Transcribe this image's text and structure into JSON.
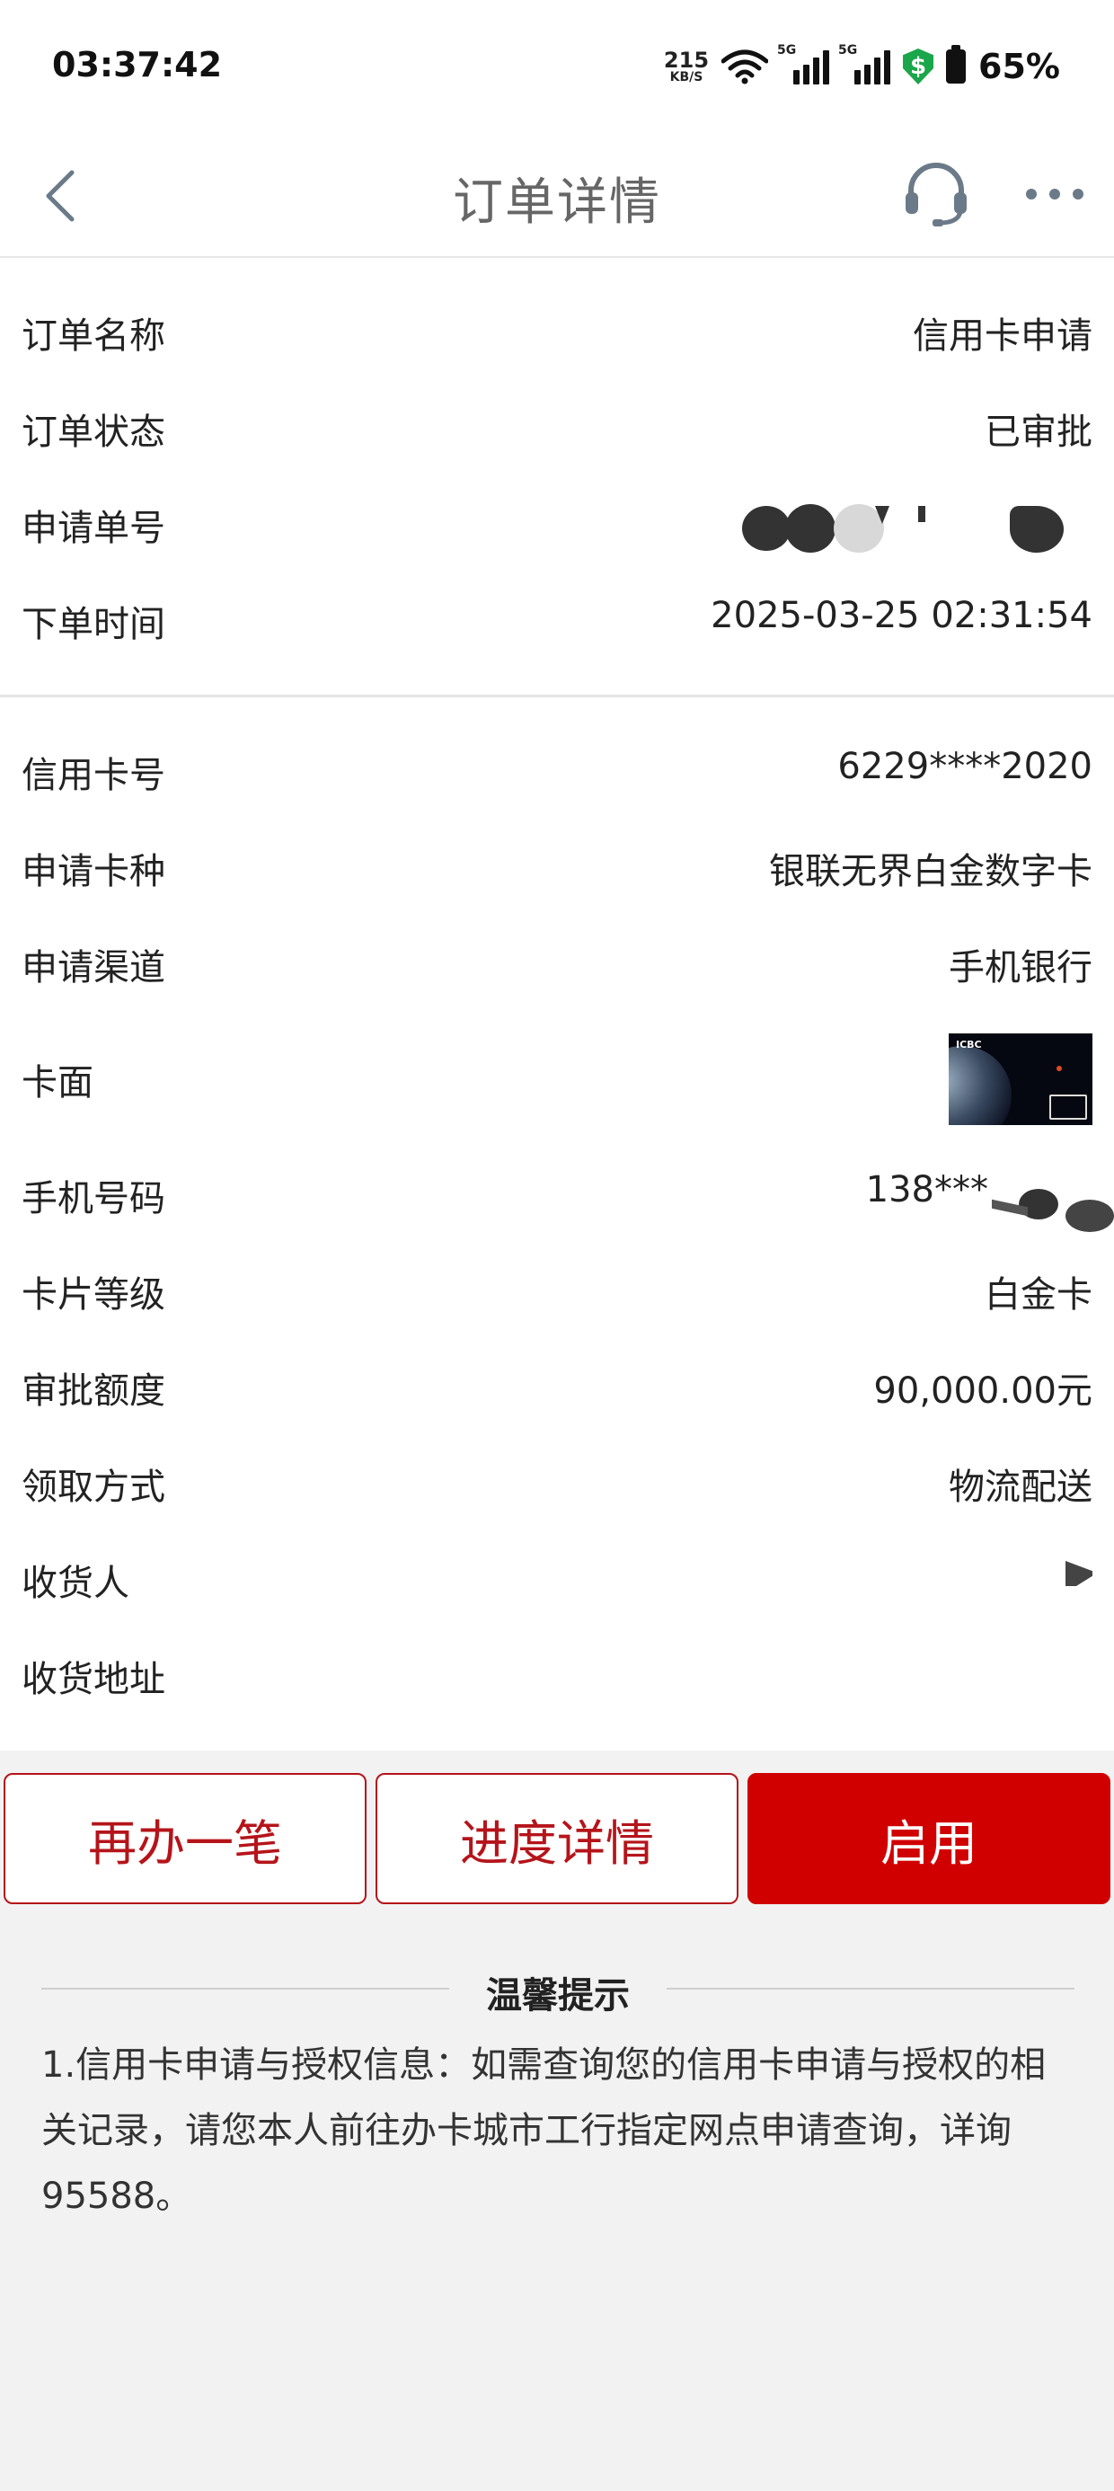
{
  "status_bar": {
    "time": "03:37:42",
    "net_speed_value": "215",
    "net_speed_unit": "KB/S",
    "signal_tag_1": "5G",
    "signal_tag_2": "5G",
    "shield_symbol": "$",
    "battery": "65%"
  },
  "header": {
    "title": "订单详情",
    "back_icon": "chevron-left-icon",
    "service_icon": "headset-icon",
    "more_icon": "more-horizontal-icon"
  },
  "order_section": {
    "name_label": "订单名称",
    "name_value": "信用卡申请",
    "status_label": "订单状态",
    "status_value": "已审批",
    "number_label": "申请单号",
    "time_label": "下单时间",
    "time_value": "2025-03-25 02:31:54"
  },
  "card_section": {
    "card_no_label": "信用卡号",
    "card_no_value": "6229****2020",
    "card_type_label": "申请卡种",
    "card_type_value": "银联无界白金数字卡",
    "channel_label": "申请渠道",
    "channel_value": "手机银行",
    "card_face_label": "卡面",
    "card_face_logo": "ICBC",
    "phone_label": "手机号码",
    "phone_value": "138***",
    "level_label": "卡片等级",
    "level_value": "白金卡",
    "limit_label": "审批额度",
    "limit_value": "90,000.00元",
    "delivery_label": "领取方式",
    "delivery_value": "物流配送",
    "receiver_label": "收货人",
    "address_label": "收货地址"
  },
  "buttons": {
    "again": "再办一笔",
    "progress": "进度详情",
    "activate": "启用"
  },
  "tips": {
    "title": "温馨提示",
    "body": "1.信用卡申请与授权信息：如需查询您的信用卡申请与授权的相关记录，请您本人前往办卡城市工行指定网点申请查询，详询95588。"
  },
  "colors": {
    "brand_red": "#d00000",
    "outline_red": "#b5141a",
    "page_bg": "#f2f2f2"
  }
}
